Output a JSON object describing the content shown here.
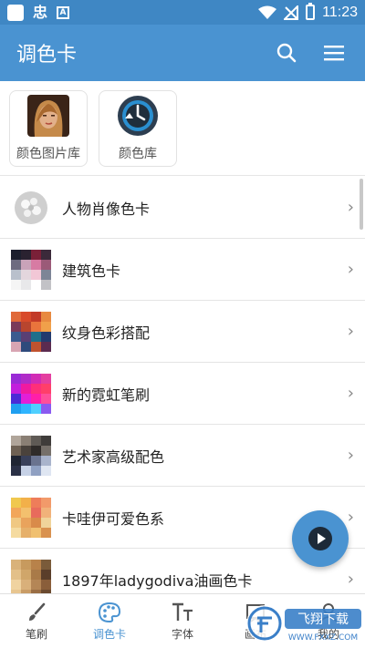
{
  "status_bar": {
    "time": "11:23",
    "badge_letter": "A"
  },
  "app_bar": {
    "title": "调色卡"
  },
  "shortcuts": [
    {
      "label": "颜色图片库"
    },
    {
      "label": "颜色库"
    }
  ],
  "list": [
    {
      "label": "人物肖像色卡",
      "icon": "flower-icon"
    },
    {
      "label": "建筑色卡",
      "colors": [
        "#1c1f2e",
        "#2a2230",
        "#7a2038",
        "#3b2a3a",
        "#6e6b80",
        "#c9a3b9",
        "#d77ba3",
        "#9b5a78",
        "#b9c0cc",
        "#e3d6dd",
        "#f2c7d6",
        "#7d8596",
        "#f5f5f5",
        "#e8e8ea",
        "#ffffff",
        "#c2c2c6"
      ]
    },
    {
      "label": "纹身色彩搭配",
      "colors": [
        "#e0693a",
        "#d84a2a",
        "#c23a28",
        "#e88a40",
        "#7a3a5a",
        "#b8452e",
        "#e9743c",
        "#f0a04a",
        "#3b5b8f",
        "#5a3f74",
        "#1f6f8b",
        "#233b6e",
        "#d8a5b3",
        "#2f4a7c",
        "#c0532f",
        "#5b2b50"
      ]
    },
    {
      "label": "新的霓虹笔刷",
      "colors": [
        "#9a2bd6",
        "#b02cc8",
        "#d12cb5",
        "#e43fa0",
        "#c21fdc",
        "#f01aa0",
        "#ff2f7a",
        "#ff3f6a",
        "#4b2bd6",
        "#e21fd8",
        "#ff1fa8",
        "#ff4f9a",
        "#1f9ff0",
        "#2fb5ff",
        "#4fd0ff",
        "#8a5af0"
      ]
    },
    {
      "label": "艺术家高级配色",
      "colors": [
        "#b0a59a",
        "#8a7f74",
        "#5f5a55",
        "#3f3c3a",
        "#6e6154",
        "#4a423c",
        "#2f2b29",
        "#76706a",
        "#1f2533",
        "#39405a",
        "#6a738f",
        "#a9b4cc",
        "#2a3046",
        "#c6d1e6",
        "#8fa0c2",
        "#dfe6f2"
      ]
    },
    {
      "label": "卡哇伊可爱色系",
      "colors": [
        "#f0c84f",
        "#f2b04a",
        "#ee7d5a",
        "#f29a6a",
        "#f2a65a",
        "#f3c06e",
        "#e86b5c",
        "#f1b27a",
        "#f0c882",
        "#e9a35c",
        "#d98b4a",
        "#f0d49a",
        "#f5dba0",
        "#e6b06a",
        "#f0c070",
        "#d9924f"
      ]
    },
    {
      "label": "1897年ladygodiva油画色卡",
      "colors": [
        "#d9b27a",
        "#c79a5e",
        "#b8824a",
        "#7a5b3a",
        "#e3c089",
        "#d0a66a",
        "#a97a48",
        "#5a3e2a",
        "#f0d3a0",
        "#d9b07a",
        "#b48656",
        "#8a5e3a",
        "#e8c690",
        "#c99c66",
        "#9a6e44",
        "#6b4a30"
      ]
    }
  ],
  "bottom_nav": [
    {
      "label": "笔刷"
    },
    {
      "label": "调色卡"
    },
    {
      "label": "字体"
    },
    {
      "label": "画布"
    },
    {
      "label": "我的"
    }
  ],
  "colors": {
    "primary": "#4a93d1",
    "status_bar": "#3f87c4"
  }
}
